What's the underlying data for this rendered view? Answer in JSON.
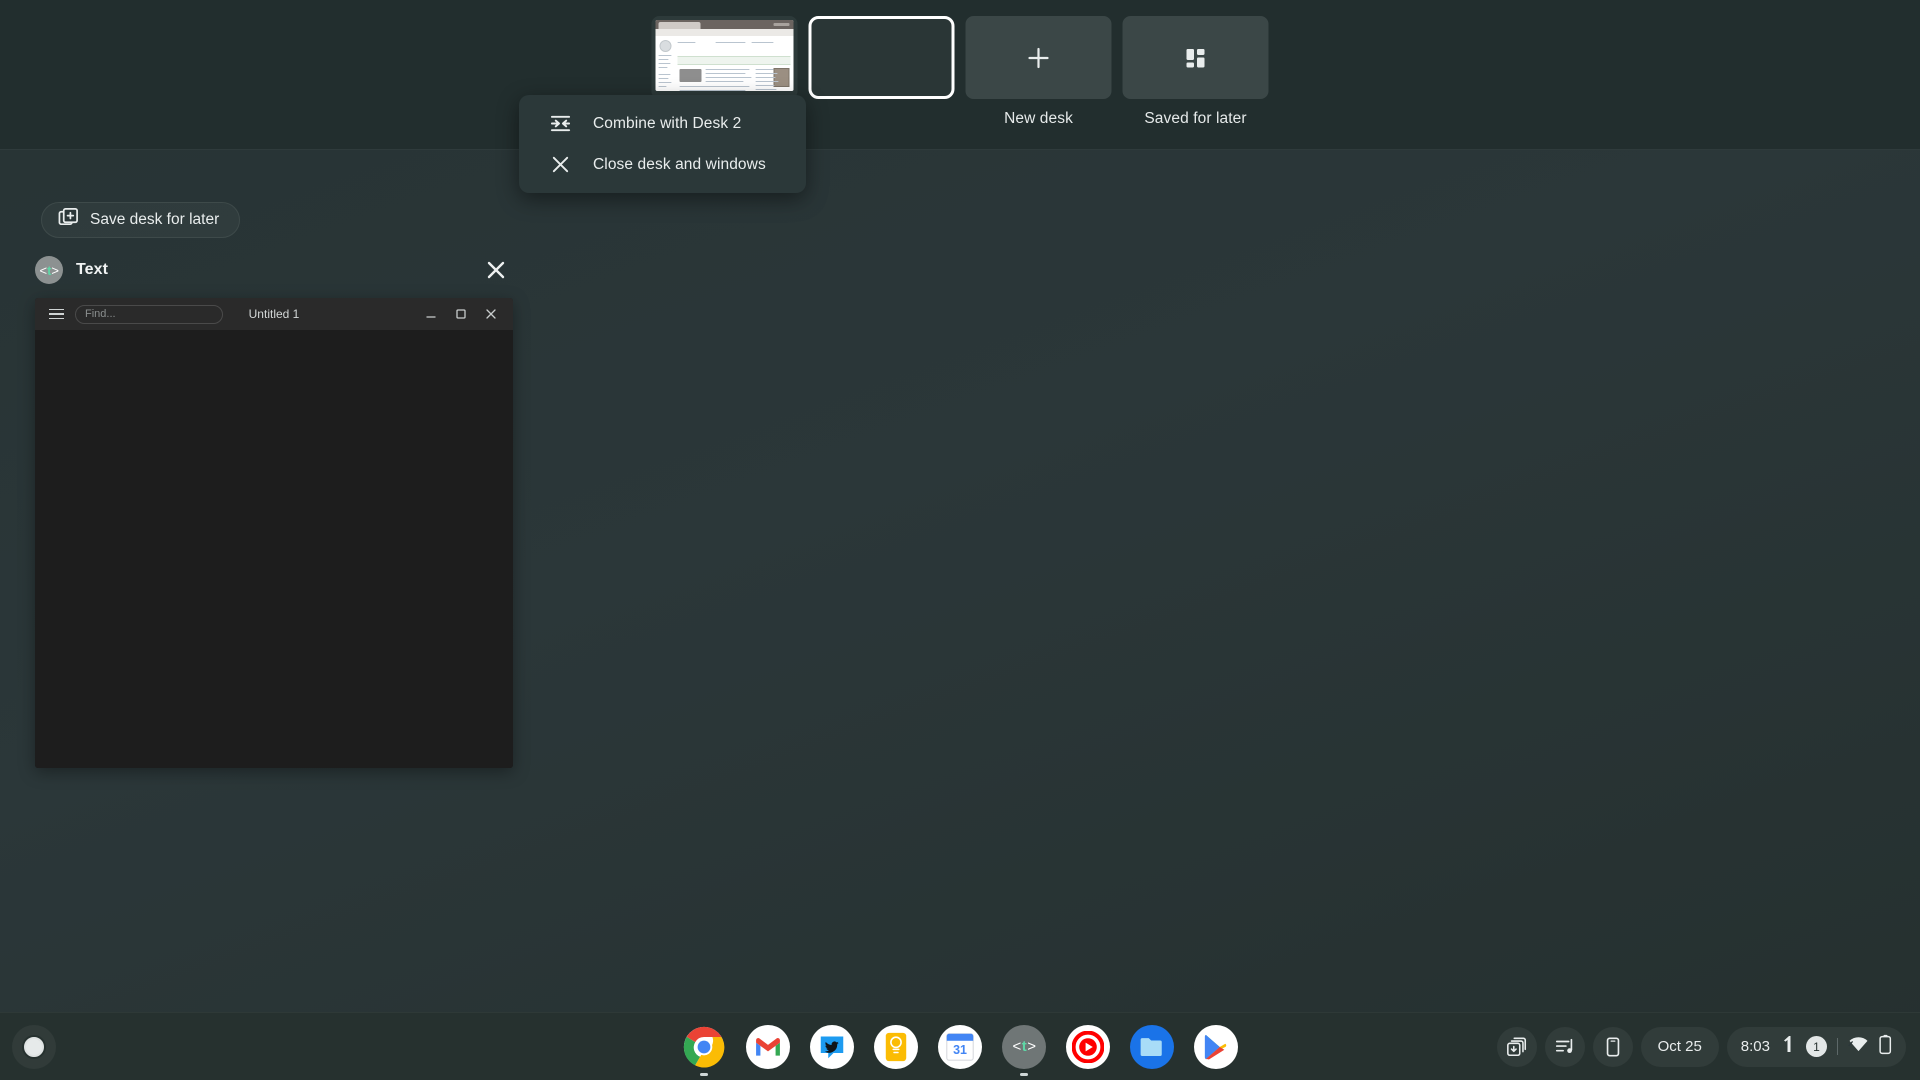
{
  "theme": {
    "background": "#2b3739",
    "desk_bar_bg": "#222e2e",
    "shelf_bg": "#26312f",
    "menu_bg": "#2b3839",
    "text_primary": "#e9eded",
    "accent_selected_border": "#ffffff",
    "window_body": "#1c1c1c"
  },
  "desk_bar": {
    "desks": [
      {
        "name": "desk-1",
        "label": "",
        "selected": false,
        "has_window_preview": true
      },
      {
        "name": "desk-2",
        "label": "",
        "selected": true,
        "has_window_preview": false
      }
    ],
    "new_desk": {
      "label": "New desk",
      "icon": "plus-icon"
    },
    "saved_for_later": {
      "label": "Saved for later",
      "icon": "desk-library-icon"
    }
  },
  "context_menu": {
    "items": [
      {
        "label": "Combine with Desk 2",
        "icon": "combine-desks-icon"
      },
      {
        "label": "Close desk and windows",
        "icon": "close-x-icon"
      }
    ]
  },
  "overview": {
    "save_desk_button": {
      "label": "Save desk for later",
      "icon": "save-desk-icon"
    },
    "window": {
      "app_name": "Text",
      "app_icon_prefix": "<",
      "app_icon_letter": "t",
      "app_icon_suffix": ">",
      "close_label": "close-icon",
      "titlebar": {
        "menu_icon": "hamburger-icon",
        "find_placeholder": "Find...",
        "find_value": "",
        "document_title": "Untitled 1",
        "minimize_icon": "minimize-icon",
        "maximize_icon": "maximize-icon",
        "close_icon": "close-icon"
      }
    }
  },
  "shelf": {
    "launcher": {
      "name": "launcher-button"
    },
    "apps": [
      {
        "name": "chrome",
        "label": "Chrome",
        "running": true
      },
      {
        "name": "gmail",
        "label": "Gmail",
        "running": false
      },
      {
        "name": "twitter",
        "label": "Twitter",
        "running": false
      },
      {
        "name": "keep",
        "label": "Keep",
        "running": false
      },
      {
        "name": "calendar",
        "label": "Calendar",
        "day": "31",
        "running": false
      },
      {
        "name": "text",
        "label": "Text",
        "running": true
      },
      {
        "name": "youtube-music",
        "label": "YouTube Music",
        "running": false
      },
      {
        "name": "files",
        "label": "Files",
        "running": false
      },
      {
        "name": "play-store",
        "label": "Play Store",
        "running": false
      }
    ],
    "tray": {
      "holding_space_icon": "holding-space-icon",
      "media_icon": "media-controls-icon",
      "phone_hub_icon": "phone-hub-icon",
      "date": "Oct 25",
      "time": "8:03",
      "ime_indicator": "ime-icon",
      "notification_count": "1",
      "network_icon": "wifi-icon",
      "battery_icon": "battery-icon"
    }
  }
}
